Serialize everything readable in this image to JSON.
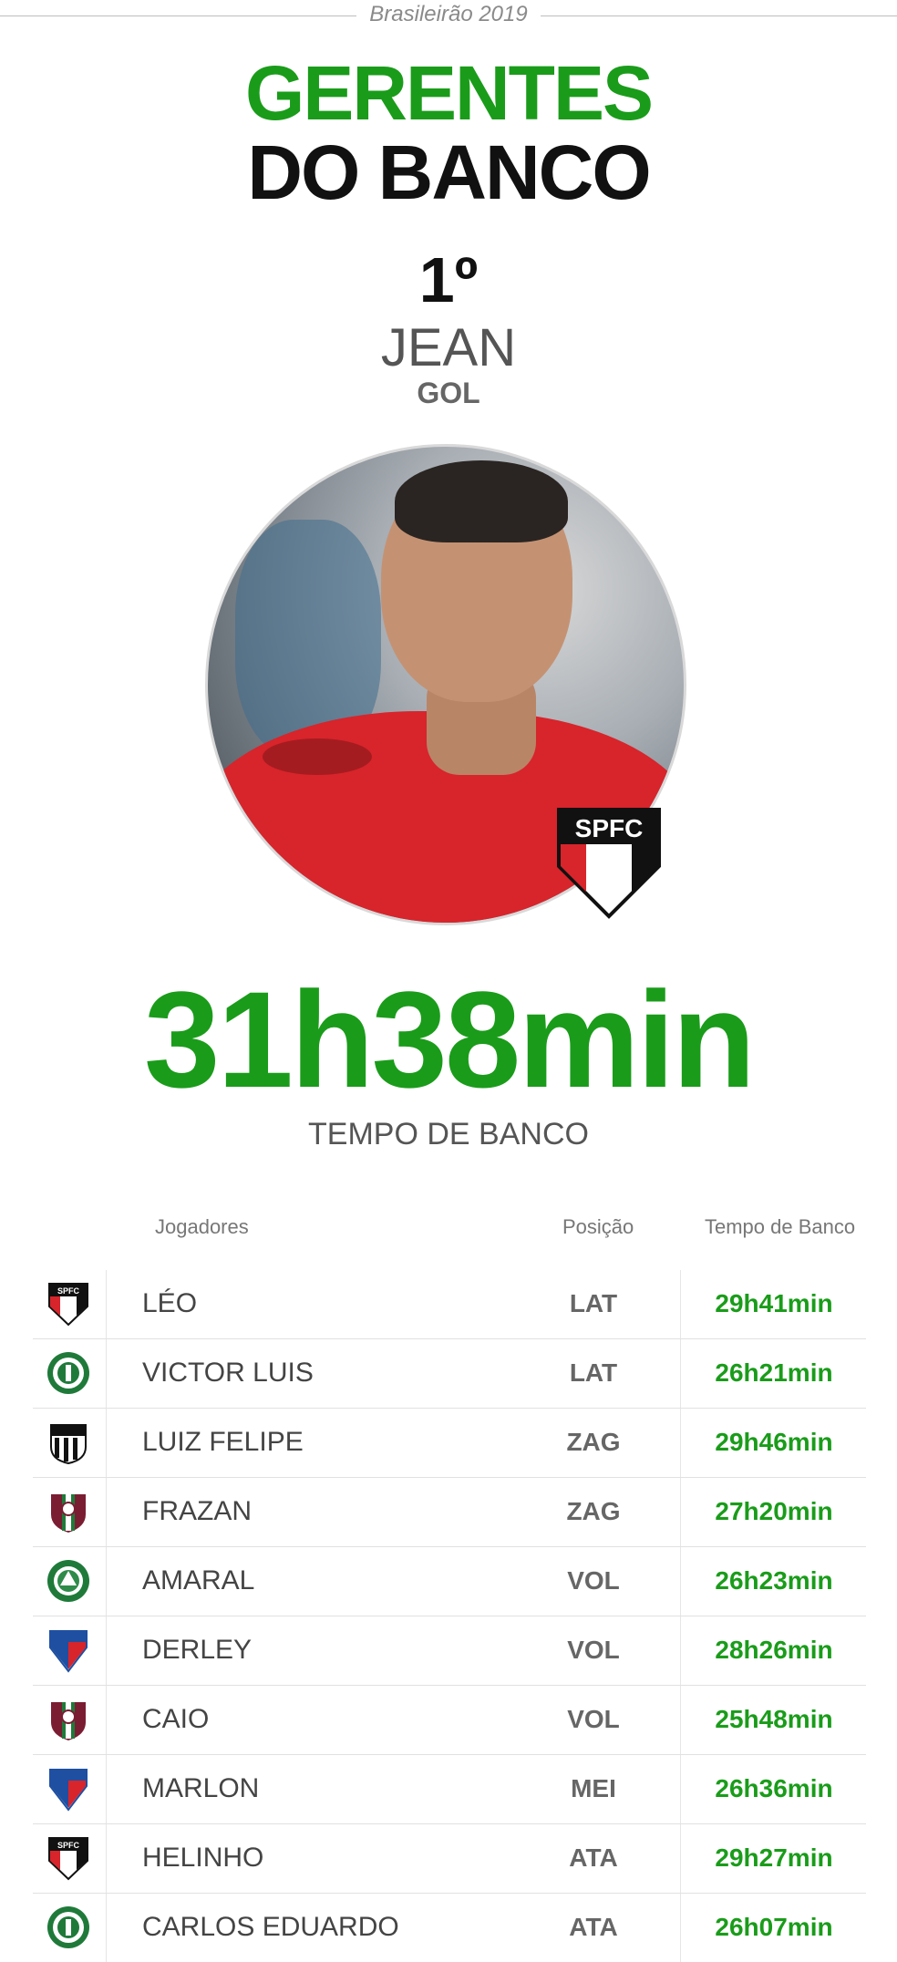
{
  "header": {
    "overline": "Brasileirão 2019",
    "title_line1": "GERENTES",
    "title_line2": "DO BANCO"
  },
  "leader": {
    "rank": "1º",
    "name": "JEAN",
    "position": "GOL",
    "club_badge_text": "SPFC",
    "bench_time": "31h38min",
    "bench_time_label": "TEMPO DE BANCO"
  },
  "colors": {
    "green": "#1a9c1a",
    "dark": "#111111",
    "gray_text": "#555555"
  },
  "table": {
    "headers": {
      "player": "Jogadores",
      "position": "Posição",
      "time": "Tempo de Banco"
    },
    "rows": [
      {
        "club": "spfc-logo",
        "player": "LÉO",
        "position": "LAT",
        "time": "29h41min"
      },
      {
        "club": "palmeiras-logo",
        "player": "VICTOR LUIS",
        "position": "LAT",
        "time": "26h21min"
      },
      {
        "club": "santos-logo",
        "player": "LUIZ FELIPE",
        "position": "ZAG",
        "time": "29h46min"
      },
      {
        "club": "fluminense-logo",
        "player": "FRAZAN",
        "position": "ZAG",
        "time": "27h20min"
      },
      {
        "club": "chapecoense-logo",
        "player": "AMARAL",
        "position": "VOL",
        "time": "26h23min"
      },
      {
        "club": "fortaleza-logo",
        "player": "DERLEY",
        "position": "VOL",
        "time": "28h26min"
      },
      {
        "club": "fluminense-logo",
        "player": "CAIO",
        "position": "VOL",
        "time": "25h48min"
      },
      {
        "club": "fortaleza-logo",
        "player": "MARLON",
        "position": "MEI",
        "time": "26h36min"
      },
      {
        "club": "spfc-logo",
        "player": "HELINHO",
        "position": "ATA",
        "time": "29h27min"
      },
      {
        "club": "palmeiras-logo",
        "player": "CARLOS EDUARDO",
        "position": "ATA",
        "time": "26h07min"
      }
    ]
  }
}
